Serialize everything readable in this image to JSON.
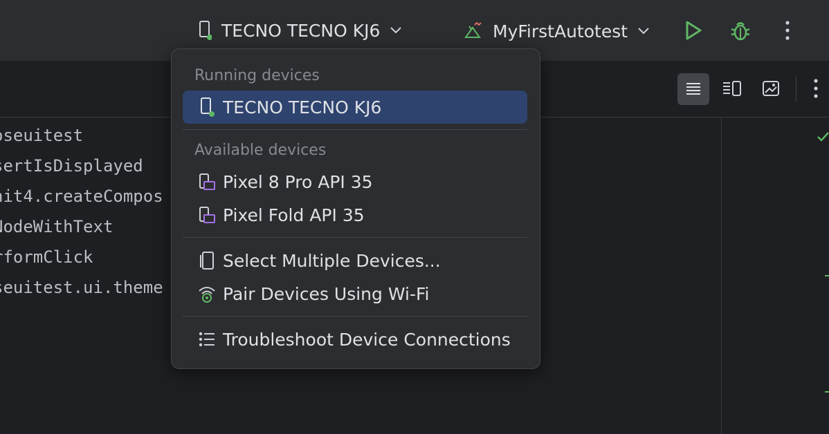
{
  "toolbar": {
    "device_label": "TECNO TECNO KJ6",
    "run_config_label": "MyFirstAutotest"
  },
  "editor": {
    "lines": [
      "oseuitest",
      "sertIsDisplayed",
      "nit4.createCompos",
      "NodeWithText",
      "rformClick",
      "seuitest.ui.theme"
    ]
  },
  "popup": {
    "running_header": "Running devices",
    "running_devices": [
      "TECNO TECNO KJ6"
    ],
    "available_header": "Available devices",
    "available_devices": [
      "Pixel 8 Pro API 35",
      "Pixel Fold API 35"
    ],
    "actions": [
      "Select Multiple Devices...",
      "Pair Devices Using Wi-Fi"
    ],
    "troubleshoot": "Troubleshoot Device Connections"
  },
  "colors": {
    "accent_green": "#5fb865",
    "selected_bg": "#2e436e",
    "emulator_purple": "#a571e6"
  }
}
